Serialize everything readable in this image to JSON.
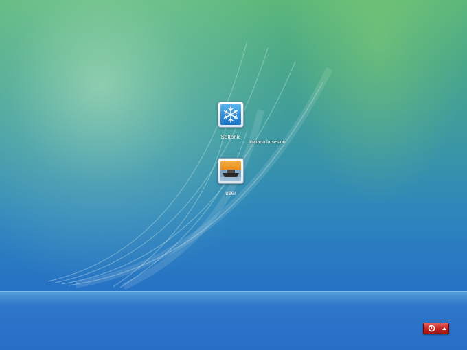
{
  "users": [
    {
      "name": "Softonic",
      "icon": "snowflake-icon",
      "status": "Iniciada la sesión"
    },
    {
      "name": "user",
      "icon": "boat-icon"
    }
  ],
  "power": {
    "shutdown_icon": "power-icon",
    "options_icon": "triangle-up-icon",
    "accent": "#c42521"
  }
}
